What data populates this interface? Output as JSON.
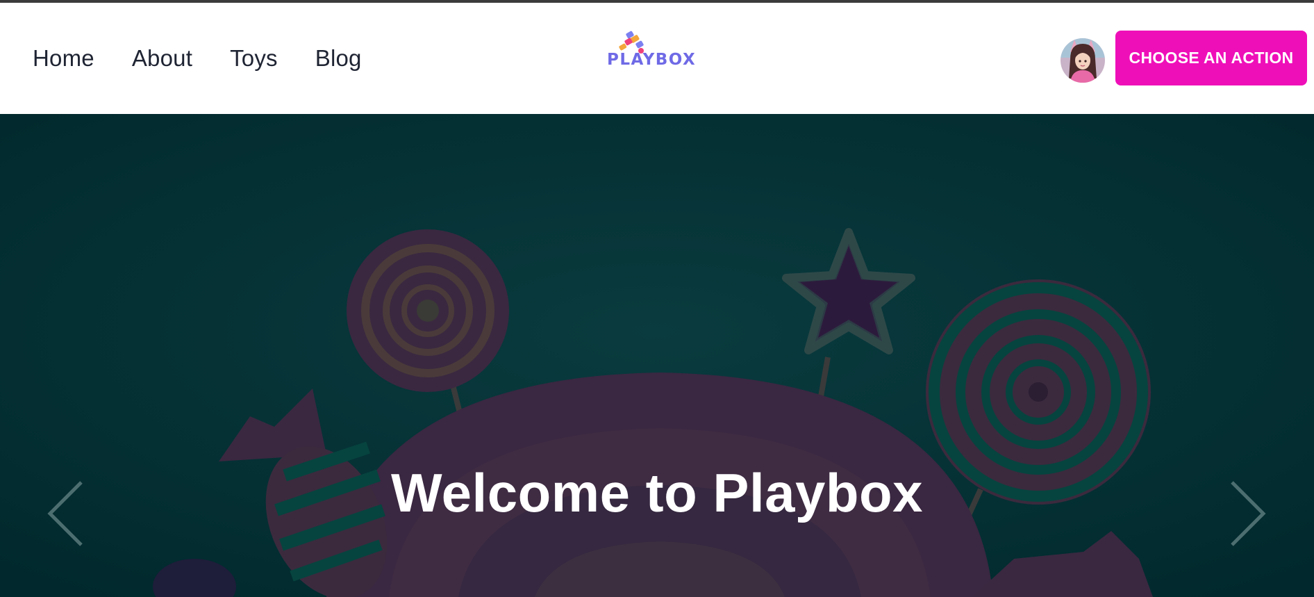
{
  "nav": {
    "links": [
      {
        "label": "Home"
      },
      {
        "label": "About"
      },
      {
        "label": "Toys"
      },
      {
        "label": "Blog"
      }
    ]
  },
  "brand": {
    "logo_text": "PLAYBOX",
    "logo_color": "#6f6ae6"
  },
  "header": {
    "cta_label": "CHOOSE AN ACTION",
    "cta_color": "#ef0fb9",
    "avatar_icon": "user-avatar"
  },
  "hero": {
    "title": "Welcome to Playbox",
    "background_color": "#02353a",
    "prev_icon": "chevron-left-icon",
    "next_icon": "chevron-right-icon"
  }
}
